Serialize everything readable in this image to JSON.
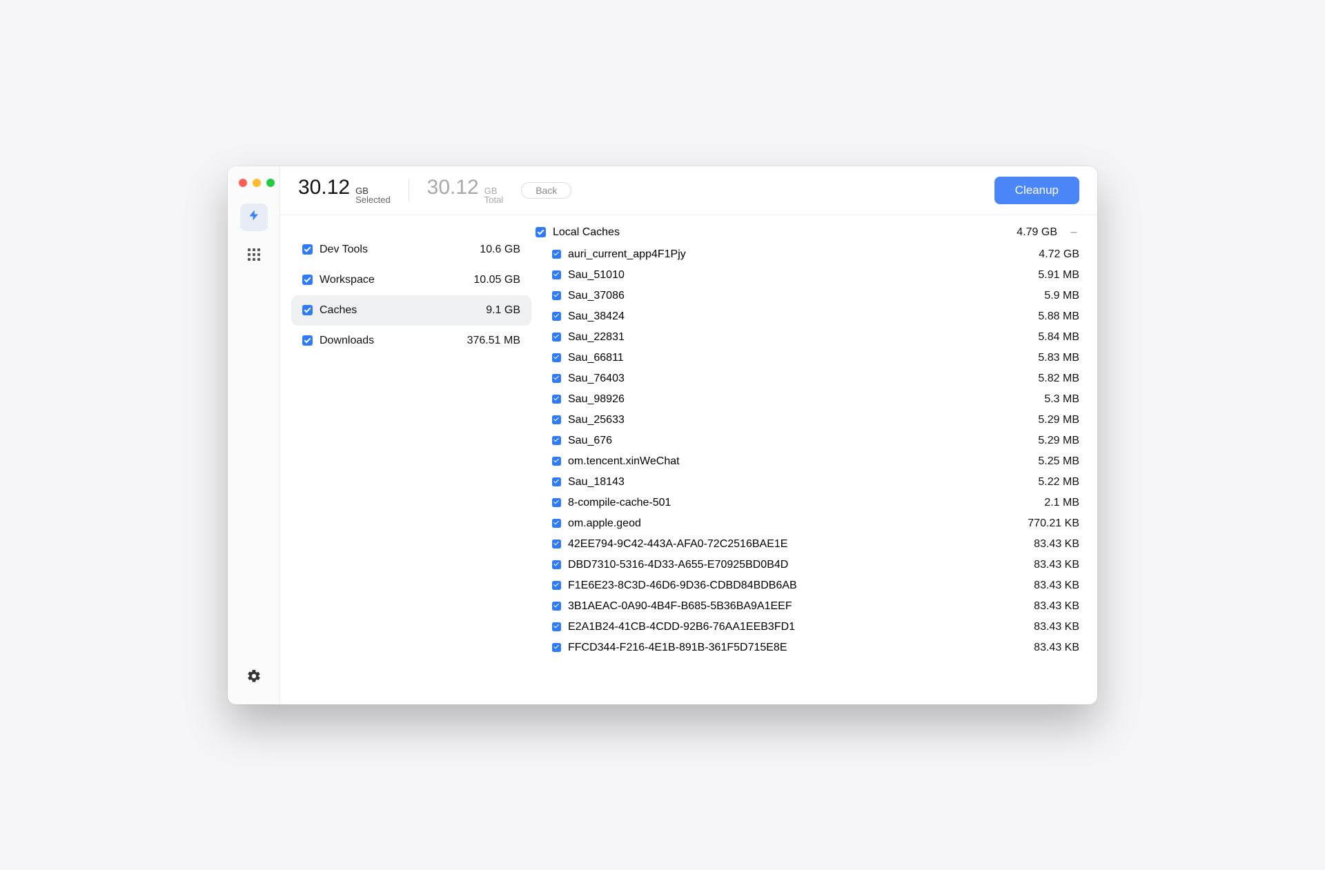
{
  "header": {
    "selected_value": "30.12",
    "selected_unit": "GB",
    "selected_label": "Selected",
    "total_value": "30.12",
    "total_unit": "GB",
    "total_label": "Total",
    "back_label": "Back",
    "cleanup_label": "Cleanup"
  },
  "categories": [
    {
      "name": "Dev Tools",
      "size": "10.6 GB",
      "checked": true,
      "active": false
    },
    {
      "name": "Workspace",
      "size": "10.05 GB",
      "checked": true,
      "active": false
    },
    {
      "name": "Caches",
      "size": "9.1 GB",
      "checked": true,
      "active": true
    },
    {
      "name": "Downloads",
      "size": "376.51 MB",
      "checked": true,
      "active": false
    }
  ],
  "group": {
    "name": "Local Caches",
    "size": "4.79 GB",
    "toggle": "–",
    "checked": true
  },
  "files": [
    {
      "name": "auri_current_app4F1Pjy",
      "size": "4.72 GB",
      "checked": true
    },
    {
      "name": "Sau_51010",
      "size": "5.91 MB",
      "checked": true
    },
    {
      "name": "Sau_37086",
      "size": "5.9 MB",
      "checked": true
    },
    {
      "name": "Sau_38424",
      "size": "5.88 MB",
      "checked": true
    },
    {
      "name": "Sau_22831",
      "size": "5.84 MB",
      "checked": true
    },
    {
      "name": "Sau_66811",
      "size": "5.83 MB",
      "checked": true
    },
    {
      "name": "Sau_76403",
      "size": "5.82 MB",
      "checked": true
    },
    {
      "name": "Sau_98926",
      "size": "5.3 MB",
      "checked": true
    },
    {
      "name": "Sau_25633",
      "size": "5.29 MB",
      "checked": true
    },
    {
      "name": "Sau_676",
      "size": "5.29 MB",
      "checked": true
    },
    {
      "name": "om.tencent.xinWeChat",
      "size": "5.25 MB",
      "checked": true
    },
    {
      "name": "Sau_18143",
      "size": "5.22 MB",
      "checked": true
    },
    {
      "name": "8-compile-cache-501",
      "size": "2.1 MB",
      "checked": true
    },
    {
      "name": "om.apple.geod",
      "size": "770.21 KB",
      "checked": true
    },
    {
      "name": "42EE794-9C42-443A-AFA0-72C2516BAE1E",
      "size": "83.43 KB",
      "checked": true
    },
    {
      "name": "DBD7310-5316-4D33-A655-E70925BD0B4D",
      "size": "83.43 KB",
      "checked": true
    },
    {
      "name": "F1E6E23-8C3D-46D6-9D36-CDBD84BDB6AB",
      "size": "83.43 KB",
      "checked": true
    },
    {
      "name": "3B1AEAC-0A90-4B4F-B685-5B36BA9A1EEF",
      "size": "83.43 KB",
      "checked": true
    },
    {
      "name": "E2A1B24-41CB-4CDD-92B6-76AA1EEB3FD1",
      "size": "83.43 KB",
      "checked": true
    },
    {
      "name": "FFCD344-F216-4E1B-891B-361F5D715E8E",
      "size": "83.43 KB",
      "checked": true
    }
  ]
}
